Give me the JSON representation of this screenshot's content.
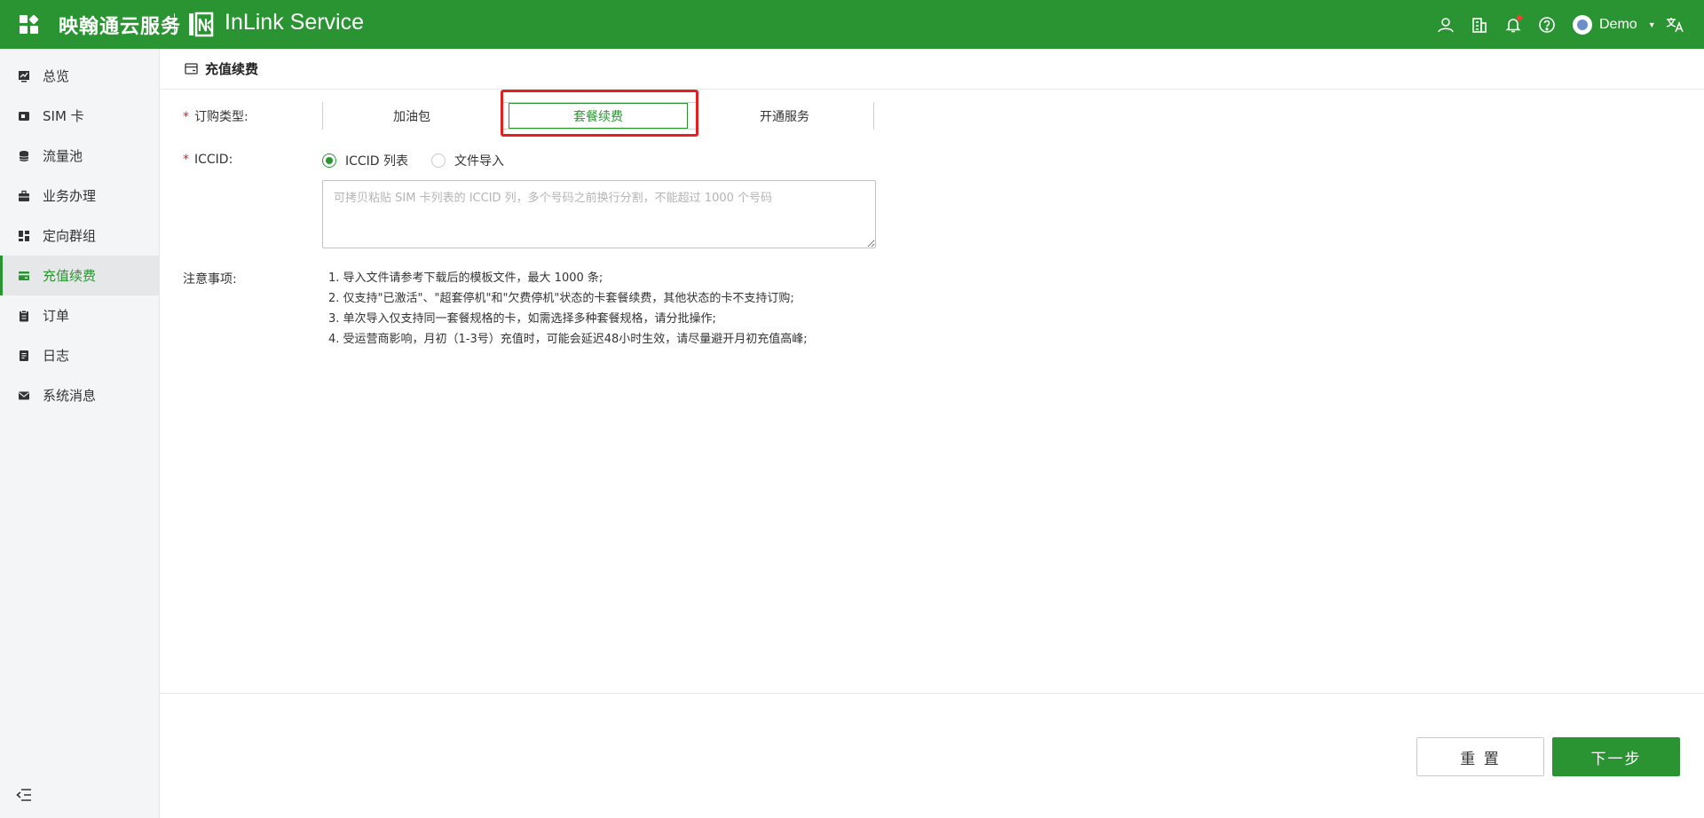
{
  "header": {
    "brand_cn": "映翰通云服务",
    "brand_en": "InLink Service",
    "user_name": "Demo",
    "icons": [
      "apps-grid-icon",
      "contacts-icon",
      "building-icon",
      "bell-icon",
      "help-icon",
      "translate-icon"
    ],
    "accent_color": "#2a9432"
  },
  "sidebar": {
    "items": [
      {
        "label": "总览",
        "icon": "chart-monitor-icon"
      },
      {
        "label": "SIM 卡",
        "icon": "sim-card-icon"
      },
      {
        "label": "流量池",
        "icon": "database-icon"
      },
      {
        "label": "业务办理",
        "icon": "briefcase-icon"
      },
      {
        "label": "定向群组",
        "icon": "dashboard-grid-icon"
      },
      {
        "label": "充值续费",
        "icon": "credit-card-icon"
      },
      {
        "label": "订单",
        "icon": "clipboard-icon"
      },
      {
        "label": "日志",
        "icon": "document-icon"
      },
      {
        "label": "系统消息",
        "icon": "mail-icon"
      }
    ],
    "active_index": 5
  },
  "page": {
    "title": "充值续费",
    "order_type_label": "订购类型:",
    "order_types": [
      "加油包",
      "套餐续费",
      "开通服务"
    ],
    "order_type_selected": "套餐续费",
    "iccid_label": "ICCID:",
    "iccid_options": [
      "ICCID 列表",
      "文件导入"
    ],
    "iccid_selected": "ICCID 列表",
    "iccid_placeholder": "可拷贝粘贴 SIM 卡列表的 ICCID 列，多个号码之前换行分割，不能超过 1000 个号码",
    "notes_label": "注意事项:",
    "notes": [
      "1. 导入文件请参考下载后的模板文件，最大 1000 条;",
      "2. 仅支持\"已激活\"、\"超套停机\"和\"欠费停机\"状态的卡套餐续费，其他状态的卡不支持订购;",
      "3. 单次导入仅支持同一套餐规格的卡，如需选择多种套餐规格，请分批操作;",
      "4. 受运营商影响，月初（1-3号）充值时，可能会延迟48小时生效，请尽量避开月初充值高峰;"
    ]
  },
  "footer": {
    "reset_label": "重 置",
    "next_label": "下一步"
  }
}
